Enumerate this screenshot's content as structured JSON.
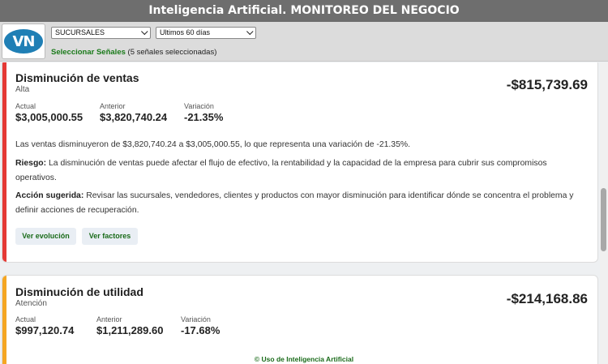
{
  "header": {
    "title": "Inteligencia Artificial. MONITOREO DEL NEGOCIO"
  },
  "logo": {
    "text": "VN"
  },
  "filters": {
    "branch": "SUCURSALES",
    "period": "Ultimos 60 días"
  },
  "signals": {
    "label": "Seleccionar Señales",
    "count_text": "(5 señales seleccionadas)"
  },
  "cards": [
    {
      "title": "Disminución de ventas",
      "level": "Alta",
      "amount": "-$815,739.69",
      "accent": "#e53935",
      "metrics": [
        {
          "label": "Actual",
          "value": "$3,005,000.55"
        },
        {
          "label": "Anterior",
          "value": "$3,820,740.24"
        },
        {
          "label": "Variación",
          "value": "-21.35%"
        }
      ],
      "summary": "Las ventas disminuyeron de $3,820,740.24 a $3,005,000.55, lo que representa una variación de -21.35%.",
      "risk_label": "Riesgo:",
      "risk": " La disminución de ventas puede afectar el flujo de efectivo, la rentabilidad y la capacidad de la empresa para cubrir sus compromisos operativos.",
      "action_label": "Acción sugerida:",
      "action": " Revisar las sucursales, vendedores, clientes y productos con mayor disminución para identificar dónde se concentra el problema y definir acciones de recuperación.",
      "buttons": [
        "Ver evolución",
        "Ver factores"
      ]
    },
    {
      "title": "Disminución de utilidad",
      "level": "Atención",
      "amount": "-$214,168.86",
      "accent": "#f5a623",
      "metrics": [
        {
          "label": "Actual",
          "value": "$997,120.74"
        },
        {
          "label": "Anterior",
          "value": "$1,211,289.60"
        },
        {
          "label": "Variación",
          "value": "-17.68%"
        }
      ]
    }
  ],
  "footer": {
    "icon": "copyright-icon",
    "text": "© Uso de Inteligencia Artificial"
  }
}
